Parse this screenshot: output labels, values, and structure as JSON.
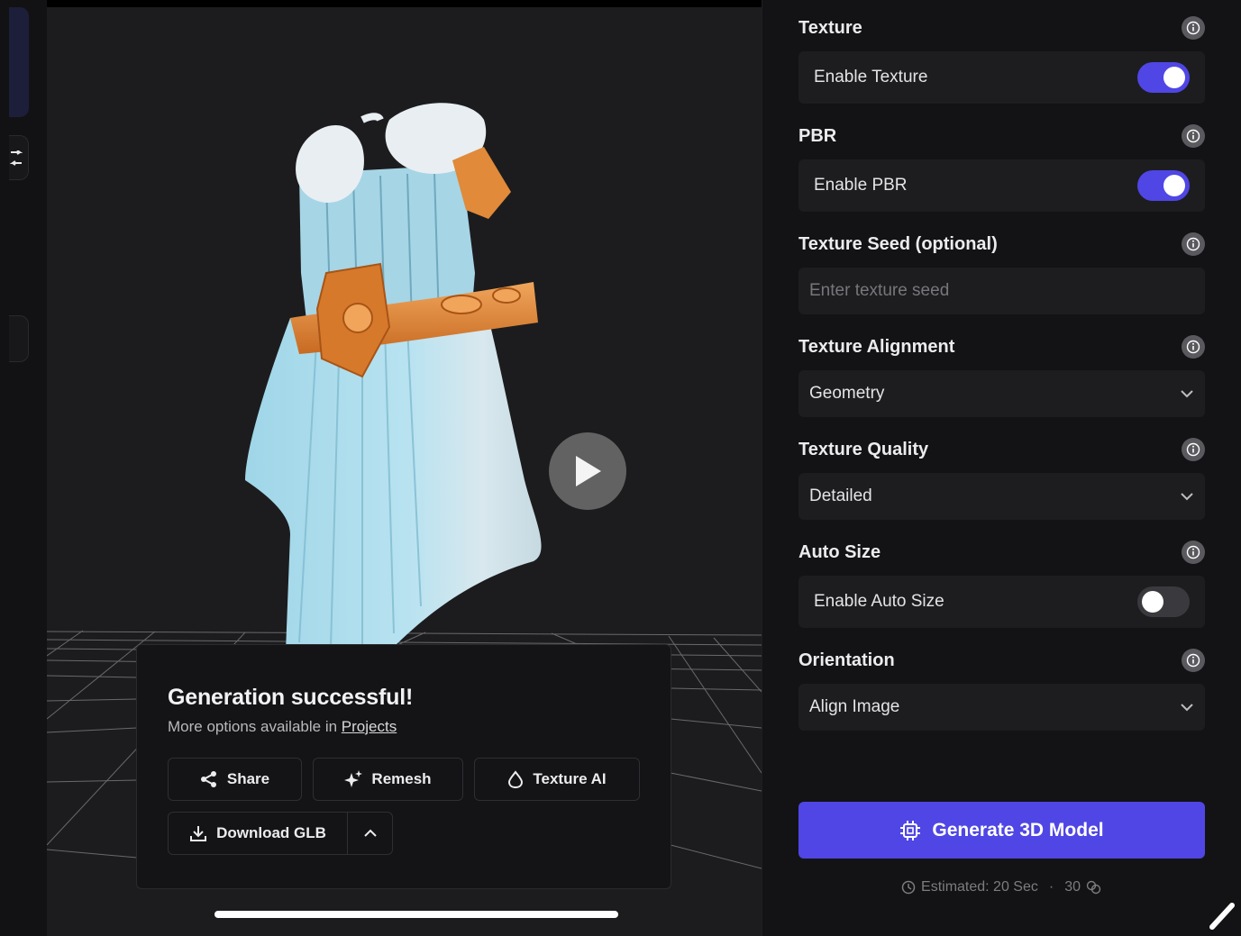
{
  "viewer": {
    "result": {
      "title": "Generation successful!",
      "subtitle_prefix": "More options available in",
      "subtitle_link": "Projects"
    },
    "actions": {
      "share": "Share",
      "remesh": "Remesh",
      "texture_ai": "Texture AI",
      "download": "Download GLB"
    }
  },
  "settings": {
    "texture": {
      "label": "Texture",
      "toggle_label": "Enable Texture",
      "enabled": true
    },
    "pbr": {
      "label": "PBR",
      "toggle_label": "Enable PBR",
      "enabled": true
    },
    "texture_seed": {
      "label": "Texture Seed (optional)",
      "value": "",
      "placeholder": "Enter texture seed"
    },
    "texture_alignment": {
      "label": "Texture Alignment",
      "value": "Geometry"
    },
    "texture_quality": {
      "label": "Texture Quality",
      "value": "Detailed"
    },
    "auto_size": {
      "label": "Auto Size",
      "toggle_label": "Enable Auto Size",
      "enabled": false
    },
    "orientation": {
      "label": "Orientation",
      "value": "Align Image"
    }
  },
  "generate": {
    "label": "Generate 3D Model",
    "estimate": "Estimated: 20 Sec",
    "credits": "30"
  },
  "colors": {
    "accent": "#4f46e5",
    "panel_bg": "#131315",
    "field_bg": "#1d1d20"
  },
  "icons": [
    "share-icon",
    "sparkle-icon",
    "drop-icon",
    "download-icon",
    "chevron-up-icon",
    "info-icon",
    "chevron-down-icon",
    "chip-icon",
    "clock-icon",
    "coins-icon",
    "play-icon",
    "pen-icon"
  ]
}
